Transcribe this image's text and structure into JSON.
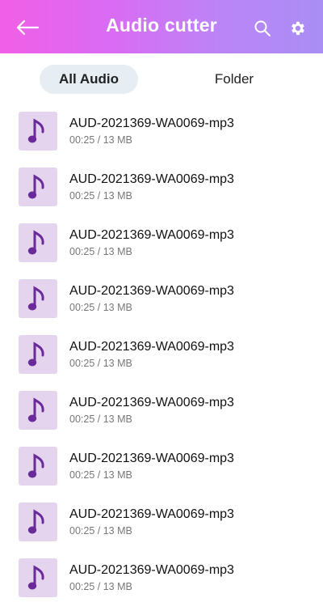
{
  "header": {
    "title": "Audio cutter",
    "back_icon": "arrow-left-icon",
    "search_icon": "search-icon",
    "settings_icon": "gear-icon"
  },
  "tabs": [
    {
      "label": "All Audio",
      "active": true
    },
    {
      "label": "Folder",
      "active": false
    }
  ],
  "files": [
    {
      "name": "AUD-2021369-WA0069-mp3",
      "meta": "00:25 / 13 MB"
    },
    {
      "name": "AUD-2021369-WA0069-mp3",
      "meta": "00:25 / 13 MB"
    },
    {
      "name": "AUD-2021369-WA0069-mp3",
      "meta": "00:25 / 13 MB"
    },
    {
      "name": "AUD-2021369-WA0069-mp3",
      "meta": "00:25 / 13 MB"
    },
    {
      "name": "AUD-2021369-WA0069-mp3",
      "meta": "00:25 / 13 MB"
    },
    {
      "name": "AUD-2021369-WA0069-mp3",
      "meta": "00:25 / 13 MB"
    },
    {
      "name": "AUD-2021369-WA0069-mp3",
      "meta": "00:25 / 13 MB"
    },
    {
      "name": "AUD-2021369-WA0069-mp3",
      "meta": "00:25 / 13 MB"
    },
    {
      "name": "AUD-2021369-WA0069-mp3",
      "meta": "00:25 / 13 MB"
    }
  ],
  "colors": {
    "header_gradient_start": "#f05fe6",
    "header_gradient_end": "#a98df5",
    "active_tab_bg": "#e6eef3",
    "thumb_bg": "#e4d4ee",
    "note_color": "#6a2a9a"
  }
}
